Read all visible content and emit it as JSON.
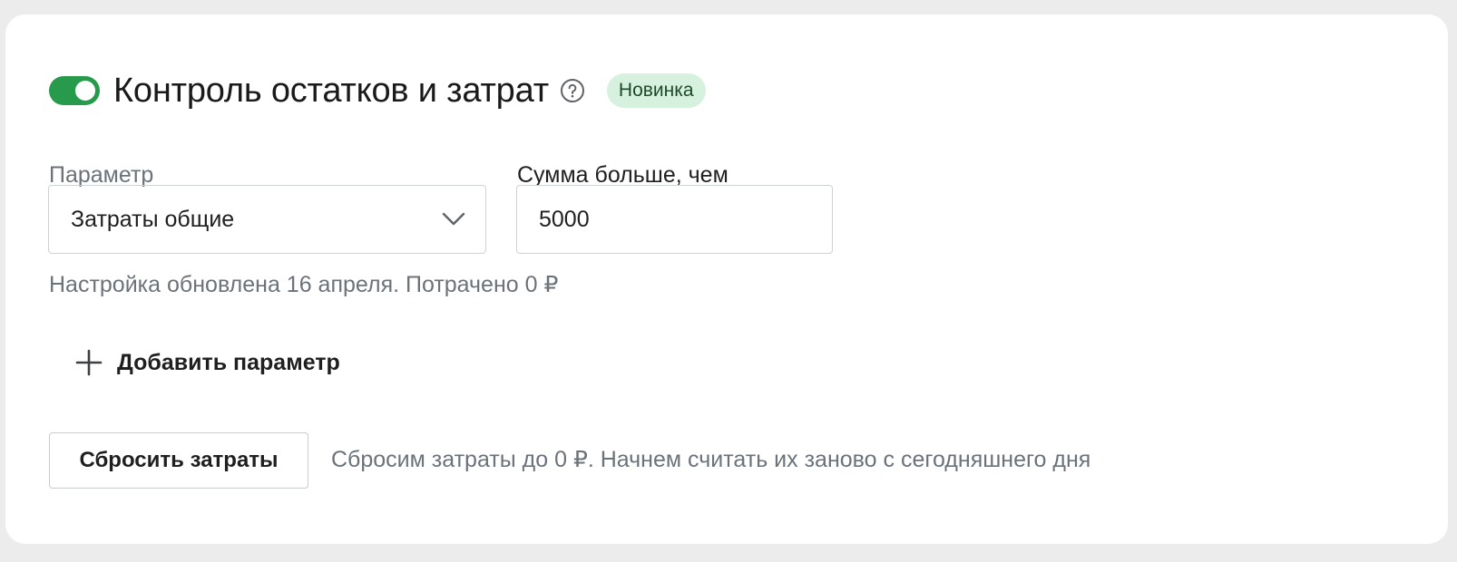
{
  "header": {
    "toggle_enabled": true,
    "title": "Контроль остатков и затрат",
    "badge": "Новинка"
  },
  "form": {
    "parameter_label": "Параметр",
    "parameter_value": "Затраты общие",
    "amount_label": "Сумма больше, чем",
    "amount_value": "5000",
    "hint": "Настройка обновлена 16 апреля. Потрачено 0 ₽"
  },
  "add_parameter": {
    "label": "Добавить параметр"
  },
  "reset": {
    "button_label": "Сбросить затраты",
    "note": "Сбросим затраты до 0 ₽. Начнем считать их заново с сегодняшнего дня"
  },
  "icons": {
    "help": "help-circle-icon",
    "dropdown": "chevron-down-icon",
    "add": "plus-icon"
  },
  "colors": {
    "toggle_on": "#279a4b",
    "badge_bg": "#d6f1dd",
    "muted_text": "#6c7279"
  }
}
